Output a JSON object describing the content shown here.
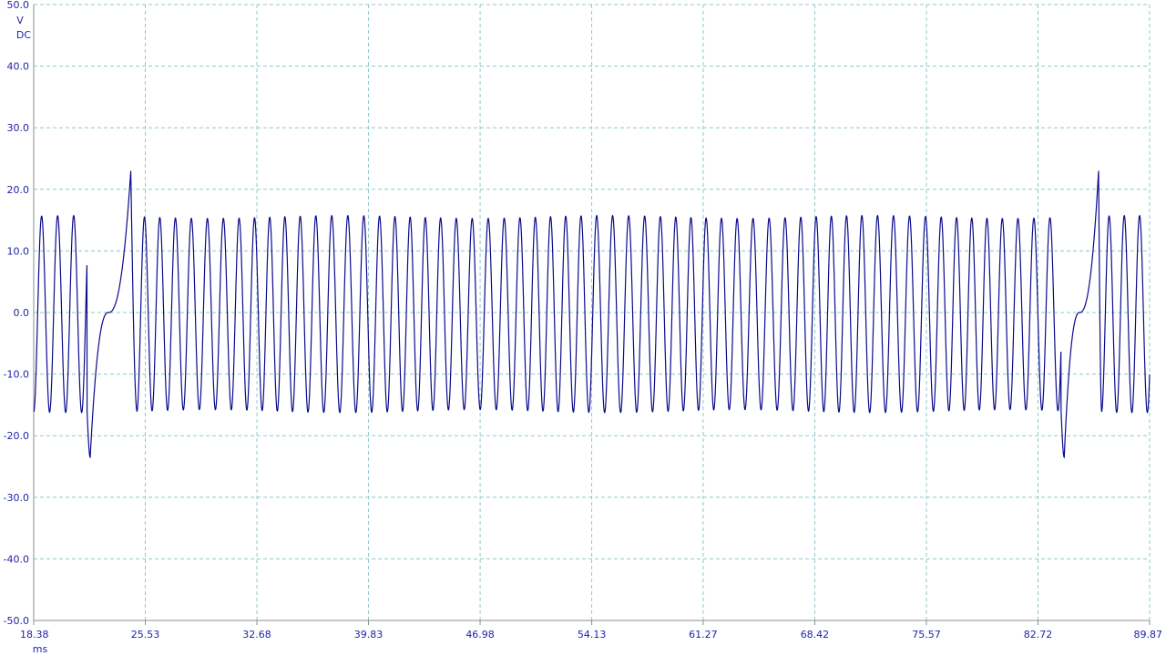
{
  "chart_data": {
    "type": "line",
    "title": "",
    "xlabel": "ms",
    "ylabel": "V",
    "coupling": "DC",
    "xlim": [
      18.38,
      89.87
    ],
    "ylim": [
      -50.0,
      50.0
    ],
    "x_ticks": [
      "18.38",
      "25.53",
      "32.68",
      "39.83",
      "46.98",
      "54.13",
      "61.27",
      "68.42",
      "75.57",
      "82.72",
      "89.87"
    ],
    "y_ticks": [
      "50.0",
      "40.0",
      "30.0",
      "20.0",
      "10.0",
      "0.0",
      "-10.0",
      "-20.0",
      "-30.0",
      "-40.0",
      "-50.0"
    ],
    "grid": true,
    "colors": {
      "trace": "#0a0a8c",
      "grid": "#8fc8cc",
      "axis": "#8c8c8c",
      "text": "#2222aa"
    },
    "series": [
      {
        "name": "",
        "sample_interval_ms": 0.01,
        "oscillation": {
          "mean_period_ms": 1.0,
          "peak_v": 15.5,
          "trough_v": -16.0,
          "cycles": 60
        },
        "gaps": [
          {
            "start_ms": 21.8,
            "end_ms": 25.0,
            "min_v": -23.5,
            "max_v": 23.0,
            "t_min_ms": 22.0,
            "t_max_ms": 24.6
          },
          {
            "start_ms": 84.2,
            "end_ms": 86.8,
            "min_v": -23.5,
            "max_v": 23.0,
            "t_min_ms": 84.4,
            "t_max_ms": 86.6
          }
        ]
      }
    ]
  }
}
